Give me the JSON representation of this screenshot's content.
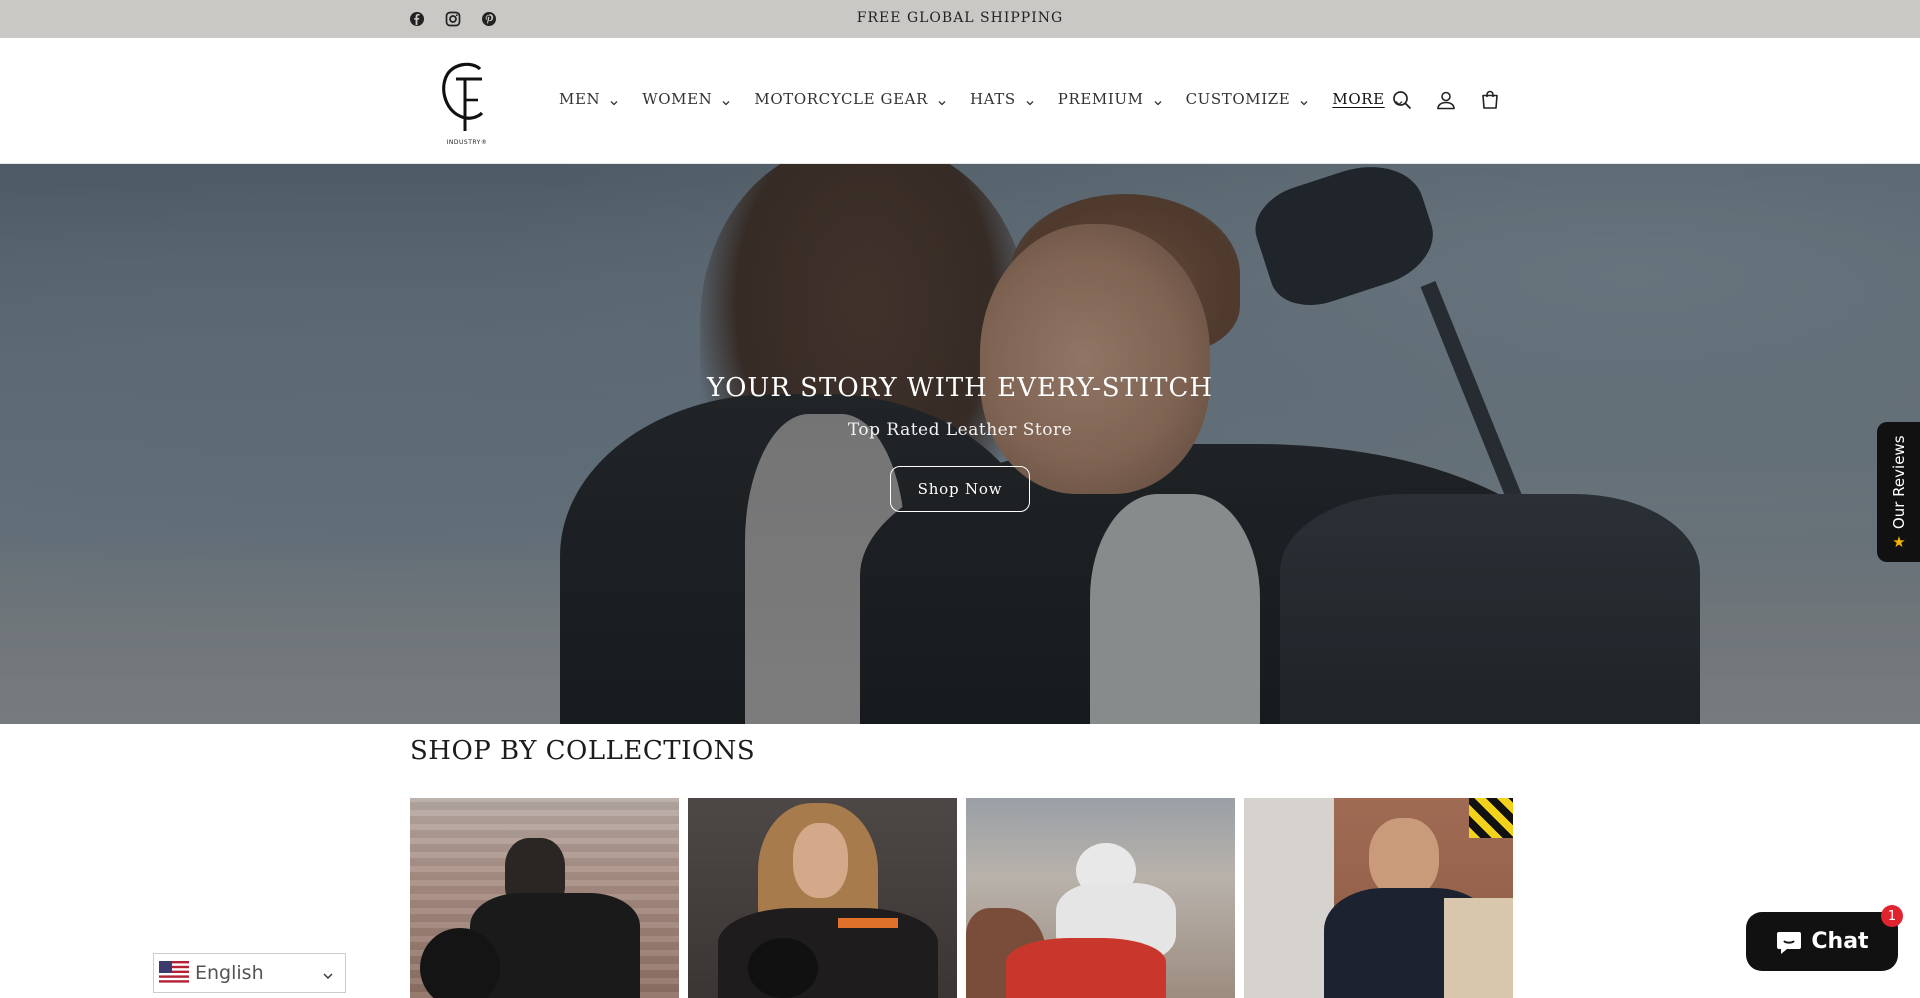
{
  "announcement": {
    "text": "FREE GLOBAL SHIPPING"
  },
  "social_icons": [
    "facebook-icon",
    "instagram-icon",
    "pinterest-icon"
  ],
  "logo": {
    "subtext": "INDUSTRY®"
  },
  "nav": {
    "items": [
      {
        "label": "MEN"
      },
      {
        "label": "WOMEN"
      },
      {
        "label": "MOTORCYCLE GEAR"
      },
      {
        "label": "HATS"
      },
      {
        "label": "PREMIUM"
      },
      {
        "label": "CUSTOMIZE"
      },
      {
        "label": "MORE"
      }
    ]
  },
  "header_icons": [
    "search-icon",
    "account-icon",
    "cart-icon"
  ],
  "hero": {
    "title": "YOUR STORY WITH EVERY-STITCH",
    "subtitle": "Top Rated Leather Store",
    "button_label": "Shop Now"
  },
  "reviews_tab": {
    "label": "Our Reviews"
  },
  "collections": {
    "title": "SHOP BY COLLECTIONS"
  },
  "language": {
    "selected": "English"
  },
  "chat": {
    "label": "Chat",
    "badge_count": "1"
  },
  "colors": {
    "announcement_bg": "#c9c8c5",
    "chat_bg": "#111111",
    "badge": "#e0242f",
    "review_star": "#f5b700"
  }
}
